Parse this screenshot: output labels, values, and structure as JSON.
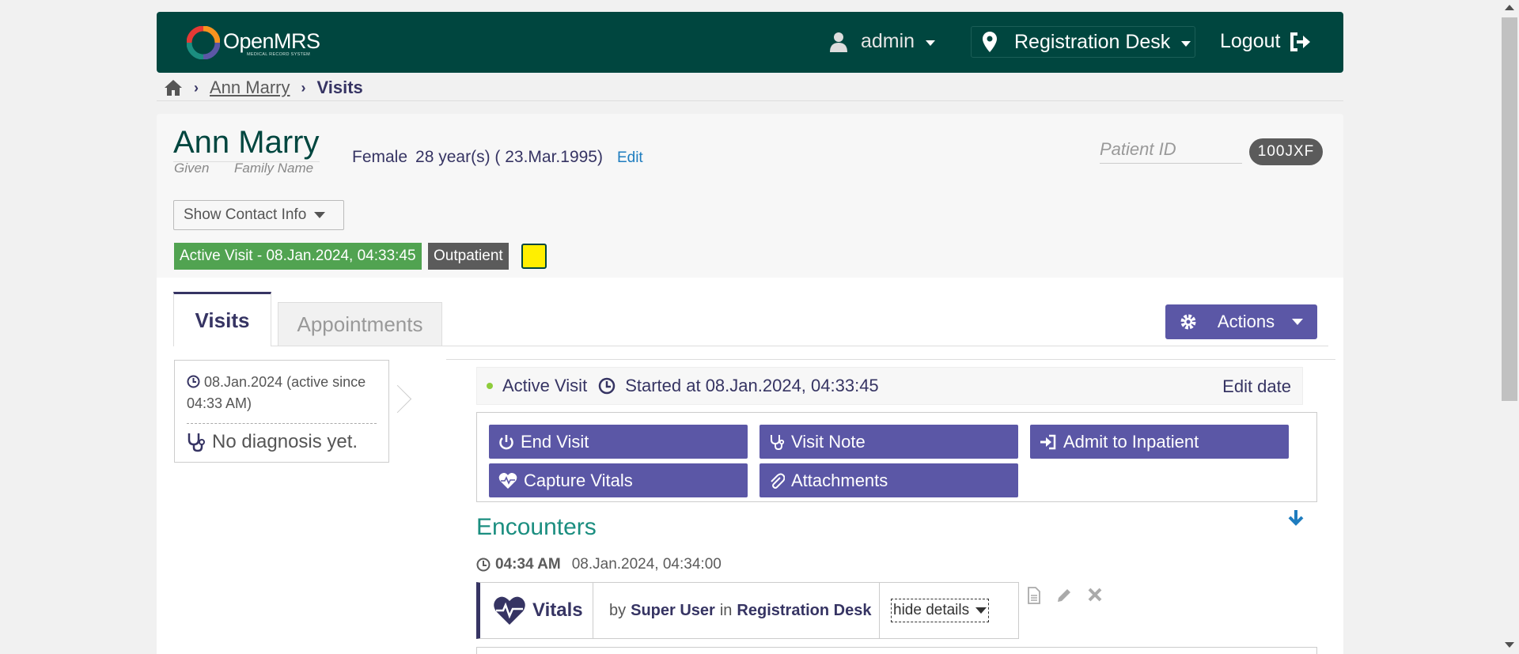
{
  "header": {
    "logo_text": "OpenMRS",
    "logo_subtext": "MEDICAL RECORD SYSTEM",
    "user": "admin",
    "location": "Registration Desk",
    "logout": "Logout"
  },
  "breadcrumb": {
    "patient": "Ann Marry",
    "current": "Visits"
  },
  "patient": {
    "name": "Ann Marry",
    "given_label": "Given",
    "family_label": "Family Name",
    "gender": "Female",
    "age": "28 year(s) ( 23.Mar.1995)",
    "edit": "Edit",
    "patient_id_label": "Patient ID",
    "patient_id": "100JXF",
    "contact_button": "Show Contact Info",
    "active_visit_badge": "Active Visit - 08.Jan.2024, 04:33:45",
    "visit_type_badge": "Outpatient"
  },
  "tabs": {
    "visits": "Visits",
    "appointments": "Appointments",
    "actions": "Actions"
  },
  "visit_list": {
    "date": "08.Jan.2024 (active since 04:33 AM)",
    "diagnosis": "No diagnosis yet."
  },
  "visit_details": {
    "status": "Active Visit",
    "started": "Started at 08.Jan.2024, 04:33:45",
    "edit_date": "Edit date",
    "buttons": {
      "end_visit": "End Visit",
      "visit_note": "Visit Note",
      "admit": "Admit to Inpatient",
      "capture_vitals": "Capture Vitals",
      "attachments": "Attachments"
    },
    "encounters_title": "Encounters",
    "encounter": {
      "time": "04:34 AM",
      "datetime": "08.Jan.2024, 04:34:00",
      "name": "Vitals",
      "by_label": "by",
      "provider": "Super User",
      "in_label": "in",
      "location": "Registration Desk",
      "hide_details": "hide details"
    }
  },
  "colors": {
    "header_bg": "#00463f",
    "primary_button": "#5b57a6",
    "active_visit_green": "#51a351",
    "badge_gray": "#5b5b5b",
    "encounters_teal": "#1b8e80"
  }
}
